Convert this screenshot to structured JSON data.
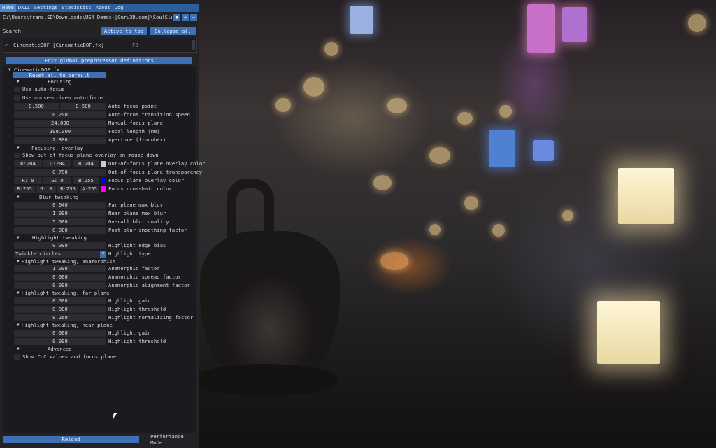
{
  "menu": [
    "Home",
    "DX11",
    "Settings",
    "Statistics",
    "About",
    "Log"
  ],
  "path": {
    "text": "C:\\Users\\frans.SD\\Downloads\\UE4_Demos-[Guru3D.com]\\SoulSlum\\Engi",
    "btn_dropdown": "▼",
    "btn_plus": "+",
    "btn_minus": "−"
  },
  "search": {
    "label": "Search",
    "active_btn": "Active to top",
    "collapse_btn": "Collapse all"
  },
  "effect": {
    "check": "✓",
    "name": "CinematicDOF [CinematicDOF.fx]",
    "key": "F8"
  },
  "defs_btn": "Edit global preprocessor definitions",
  "tree": {
    "root": "CinematicDOF.fx",
    "reset": "Reset all to default",
    "focusing": "Focusing",
    "use_autofocus": "Use auto-focus",
    "use_mouse": "Use mouse-driven auto-focus",
    "af_point_x": "0.500",
    "af_point_y": "0.500",
    "af_point_lbl": "Auto-focus point",
    "af_speed": "0.200",
    "af_speed_lbl": "Auto-focus transition speed",
    "manual_plane": "24.090",
    "manual_plane_lbl": "Manual-focus plane",
    "focal_len": "100.000",
    "focal_len_lbl": "Focal length (mm)",
    "aperture": "2.800",
    "aperture_lbl": "Aperture (f-number)",
    "overlay": "Focusing, overlay",
    "show_oof": "Show out-of-focus plane overlay on mouse down",
    "oof_r": "R:204",
    "oof_g": "G:204",
    "oof_b": "B:204",
    "oof_color_lbl": "Out-of-focus plane overlay color",
    "oof_transp": "0.700",
    "oof_transp_lbl": "Out-of-focus plane transparency",
    "fp_r": "R:  0",
    "fp_g": "G:  0",
    "fp_b": "B:255",
    "fp_color_lbl": "Focus plane overlay color",
    "ch_r": "R:255",
    "ch_g": "G:  0",
    "ch_b": "B:255",
    "ch_a": "A:255",
    "ch_color_lbl": "Focus crosshair color",
    "blur": "Blur tweaking",
    "far_max": "0.040",
    "far_max_lbl": "Far plane max blur",
    "near_max": "1.000",
    "near_max_lbl": "Near plane max blur",
    "quality": "5.000",
    "quality_lbl": "Overall blur quality",
    "postblur": "0.000",
    "postblur_lbl": "Post-blur smoothing factor",
    "highlight": "Highlight tweaking",
    "edge_bias": "0.000",
    "edge_bias_lbl": "Highlight edge bias",
    "hl_type": "Twinkle circles",
    "hl_type_lbl": "Highlight type",
    "anamorph": "Highlight tweaking, anamorphism",
    "ana_factor": "1.000",
    "ana_factor_lbl": "Anamorphic factor",
    "ana_spread": "0.000",
    "ana_spread_lbl": "Anamorphic spread factor",
    "ana_align": "0.000",
    "ana_align_lbl": "Anamorphic alignment factor",
    "far": "Highlight tweaking, far plane",
    "far_gain": "0.000",
    "far_gain_lbl": "Highlight gain",
    "far_thresh": "0.000",
    "far_thresh_lbl": "Highlight threshold",
    "far_norm": "0.260",
    "far_norm_lbl": "Highlight normalizing factor",
    "near": "Highlight tweaking, near plane",
    "near_gain": "0.000",
    "near_gain_lbl": "Highlight gain",
    "near_thresh": "0.000",
    "near_thresh_lbl": "Highlight threshold",
    "advanced": "Advanced",
    "show_coc": "Show CoC values and focus plane"
  },
  "bottom": {
    "reload": "Reload",
    "perf": "Performance Mode"
  },
  "colors": {
    "accent": "#3d70b5",
    "menubar": "#2b5fa0",
    "oof_swatch": "#cccccc",
    "fp_swatch": "#0000ff",
    "ch_swatch": "#ff00ff"
  },
  "icons": {
    "check": "check-icon",
    "collapse": "triangle-down-icon",
    "cursor": "mouse-pointer-icon"
  }
}
